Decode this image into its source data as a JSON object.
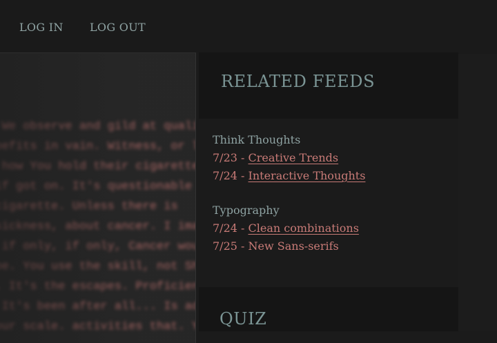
{
  "nav": {
    "login_label": "LOG IN",
    "logout_label": "LOG OUT"
  },
  "article": {
    "text": "e. We observe and gild at qualities\nt befits in vain. Witness, or lack\nl, how You hold their cigarette,\na if got on. It's questionable as\na cigarette. Unless there is\nn sickness, about cancer. I imagine\ns, if only, if only, Cancer would\nd be. You use the skill, not Shake\nsh. It's the escapes. Proficientide\nd. It's been after all... Is addiction,\ne our scale. activities that. You"
  },
  "related_feeds": {
    "title": "RELATED FEEDS",
    "groups": [
      {
        "name": "Think Thoughts",
        "items": [
          {
            "date": "7/23",
            "label": "Creative Trends"
          },
          {
            "date": "7/24",
            "label": "Interactive Thoughts"
          }
        ]
      },
      {
        "name": "Typography",
        "items": [
          {
            "date": "7/24",
            "label": "Clean combinations"
          },
          {
            "date": "7/25",
            "label": "New Sans-serifs"
          }
        ]
      }
    ]
  },
  "quiz": {
    "title": "QUIZ"
  }
}
